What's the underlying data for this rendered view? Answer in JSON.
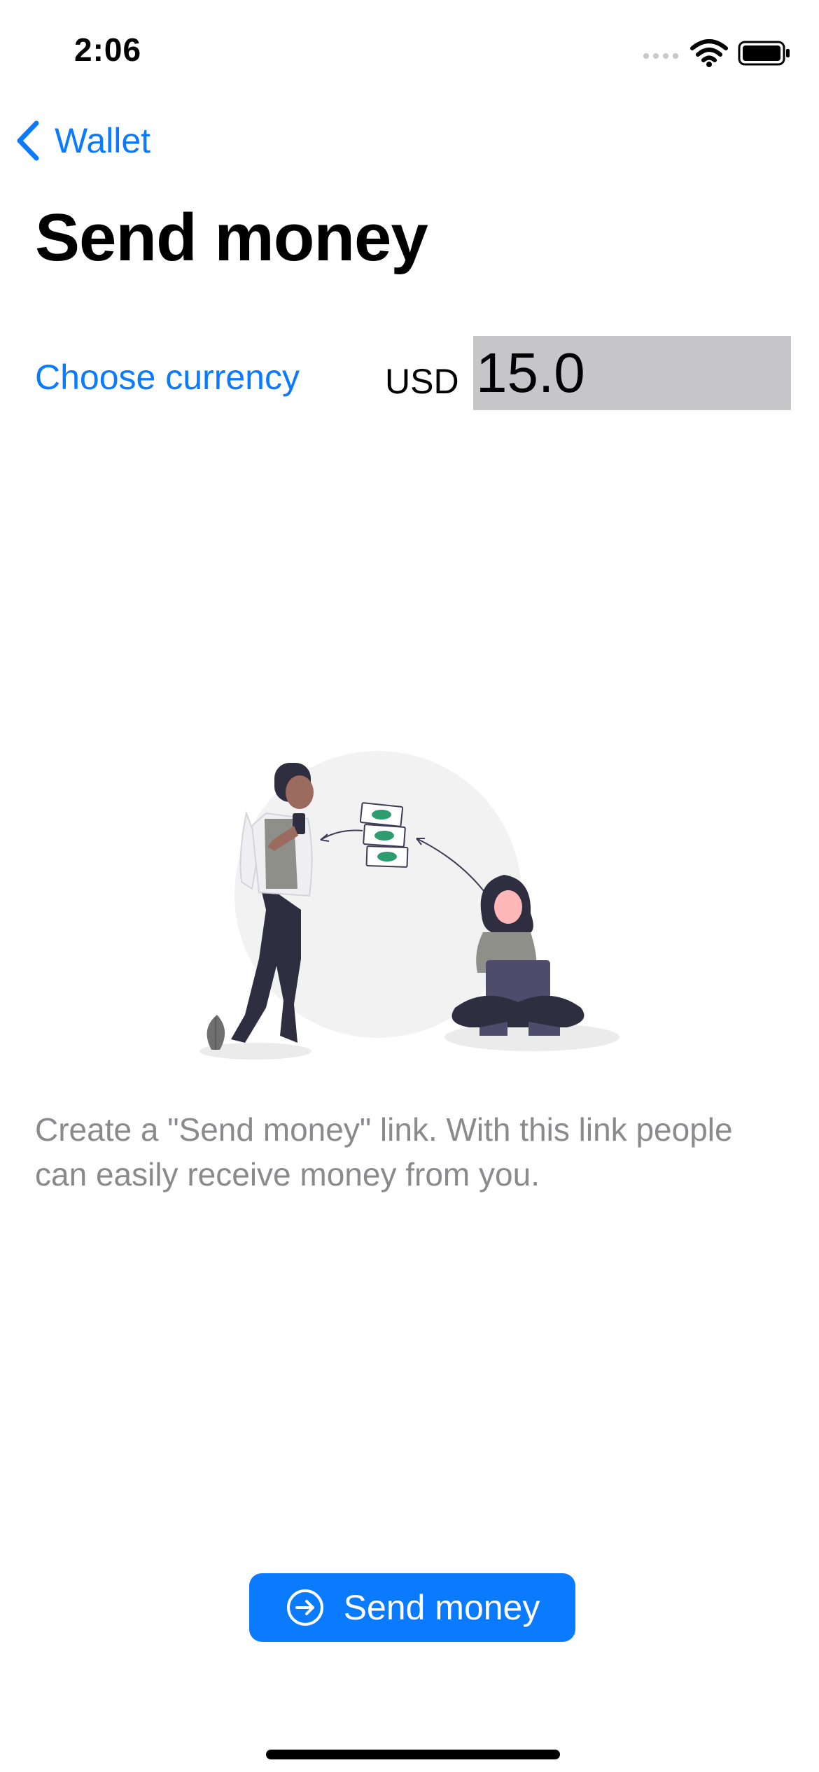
{
  "status_bar": {
    "time": "2:06",
    "icons": [
      "cellular-signal-icon",
      "wifi-icon",
      "battery-icon"
    ]
  },
  "nav": {
    "back_label": "Wallet",
    "back_icon": "chevron-left-icon"
  },
  "page": {
    "title": "Send money"
  },
  "currency": {
    "choose_label": "Choose currency",
    "code": "USD",
    "amount": "15.0"
  },
  "description": "Create a \"Send money\" link. With this link people can easily receive money from you.",
  "send_button": {
    "label": "Send money",
    "icon": "arrow-right-circle-icon"
  },
  "colors": {
    "accent": "#0a7aff",
    "input_bg": "#c6c6c8",
    "secondary_text": "#8a8a8e"
  }
}
